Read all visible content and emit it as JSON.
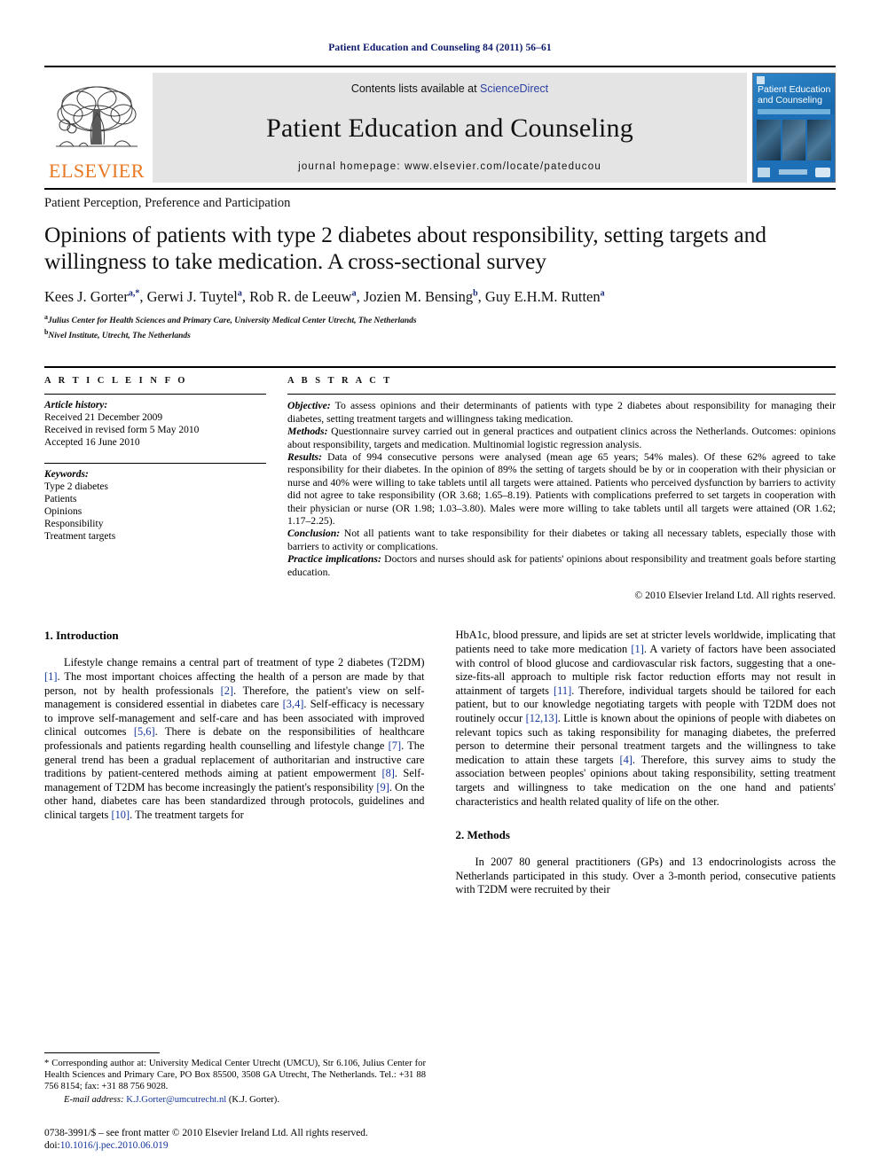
{
  "running_head": "Patient Education and Counseling 84 (2011) 56–61",
  "masthead": {
    "contents_prefix": "Contents lists available at",
    "sciencedirect": "ScienceDirect",
    "journal_title": "Patient Education and Counseling",
    "homepage": "journal homepage: www.elsevier.com/locate/pateducou",
    "publisher": "ELSEVIER",
    "cover_title": "Patient Education and Counseling",
    "link_color": "#2b3fa0",
    "brand_orange": "#e87722"
  },
  "section_heading": "Patient Perception, Preference and Participation",
  "article": {
    "title": "Opinions of patients with type 2 diabetes about responsibility, setting targets and willingness to take medication. A cross-sectional survey",
    "authors_html": "Kees J. Gorter<sup>a,*</sup>, Gerwi J. Tuytel<sup>a</sup>, Rob R. de Leeuw<sup>a</sup>, Jozien M. Bensing<sup>b</sup>, Guy E.H.M. Rutten<sup>a</sup>",
    "affiliation_a": "Julius Center for Health Sciences and Primary Care, University Medical Center Utrecht, The Netherlands",
    "affiliation_b": "Nivel Institute, Utrecht, The Netherlands"
  },
  "article_info": {
    "kicker": "A R T I C L E   I N F O",
    "history_label": "Article history:",
    "history": [
      "Received 21 December 2009",
      "Received in revised form 5 May 2010",
      "Accepted 16 June 2010"
    ],
    "keywords_label": "Keywords:",
    "keywords": [
      "Type 2 diabetes",
      "Patients",
      "Opinions",
      "Responsibility",
      "Treatment targets"
    ]
  },
  "abstract": {
    "kicker": "A B S T R A C T",
    "objective_label": "Objective:",
    "objective": "To assess opinions and their determinants of patients with type 2 diabetes about responsibility for managing their diabetes, setting treatment targets and willingness taking medication.",
    "methods_label": "Methods:",
    "methods": "Questionnaire survey carried out in general practices and outpatient clinics across the Netherlands. Outcomes: opinions about responsibility, targets and medication. Multinomial logistic regression analysis.",
    "results_label": "Results:",
    "results": "Data of 994 consecutive persons were analysed (mean age 65 years; 54% males). Of these 62% agreed to take responsibility for their diabetes. In the opinion of 89% the setting of targets should be by or in cooperation with their physician or nurse and 40% were willing to take tablets until all targets were attained. Patients who perceived dysfunction by barriers to activity did not agree to take responsibility (OR 3.68; 1.65–8.19). Patients with complications preferred to set targets in cooperation with their physician or nurse (OR 1.98; 1.03–3.80). Males were more willing to take tablets until all targets were attained (OR 1.62; 1.17–2.25).",
    "conclusion_label": "Conclusion:",
    "conclusion": "Not all patients want to take responsibility for their diabetes or taking all necessary tablets, especially those with barriers to activity or complications.",
    "implications_label": "Practice implications:",
    "implications": "Doctors and nurses should ask for patients' opinions about responsibility and treatment goals before starting education.",
    "copyright": "© 2010 Elsevier Ireland Ltd. All rights reserved."
  },
  "body": {
    "intro_heading": "1. Introduction",
    "intro_left_1": "Lifestyle change remains a central part of treatment of type 2 diabetes (T2DM) ",
    "intro_left_r1": "[1]",
    "intro_left_2": ". The most important choices affecting the health of a person are made by that person, not by health professionals ",
    "intro_left_r2": "[2]",
    "intro_left_3": ". Therefore, the patient's view on self-management is considered essential in diabetes care ",
    "intro_left_r3": "[3,4]",
    "intro_left_4": ". Self-efficacy is necessary to improve self-management and self-care and has been associated with improved clinical outcomes ",
    "intro_left_r4": "[5,6]",
    "intro_left_5": ". There is debate on the responsibilities of healthcare professionals and patients regarding health counselling and lifestyle change ",
    "intro_left_r5": "[7]",
    "intro_left_6": ". The general trend has been a gradual replacement of authoritarian and instructive care traditions by patient-centered methods aiming at patient empowerment ",
    "intro_left_r6": "[8]",
    "intro_left_7": ". Self-management of T2DM has become increasingly the patient's responsibility ",
    "intro_left_r7": "[9]",
    "intro_left_8": ". On the other hand, diabetes care has been standardized through protocols, guidelines and clinical targets ",
    "intro_left_r8": "[10]",
    "intro_left_9": ". The treatment targets for",
    "intro_right_1": "HbA1c, blood pressure, and lipids are set at stricter levels worldwide, implicating that patients need to take more medication ",
    "intro_right_r1": "[1]",
    "intro_right_2": ". A variety of factors have been associated with control of blood glucose and cardiovascular risk factors, suggesting that a one-size-fits-all approach to multiple risk factor reduction efforts may not result in attainment of targets ",
    "intro_right_r2": "[11]",
    "intro_right_3": ". Therefore, individual targets should be tailored for each patient, but to our knowledge negotiating targets with people with T2DM does not routinely occur ",
    "intro_right_r3": "[12,13]",
    "intro_right_4": ". Little is known about the opinions of people with diabetes on relevant topics such as taking responsibility for managing diabetes, the preferred person to determine their personal treatment targets and the willingness to take medication to attain these targets ",
    "intro_right_r4": "[4]",
    "intro_right_5": ". Therefore, this survey aims to study the association between peoples' opinions about taking responsibility, setting treatment targets and willingness to take medication on the one hand and patients' characteristics and health related quality of life on the other.",
    "methods_heading": "2. Methods",
    "methods_para": "In 2007 80 general practitioners (GPs) and 13 endocrinologists across the Netherlands participated in this study. Over a 3-month period, consecutive patients with T2DM were recruited by their"
  },
  "footnotes": {
    "corresponding": "* Corresponding author at: University Medical Center Utrecht (UMCU), Str 6.106, Julius Center for Health Sciences and Primary Care, PO Box 85500, 3508 GA Utrecht, The Netherlands. Tel.: +31 88 756 8154; fax: +31 88 756 9028.",
    "email_label": "E-mail address:",
    "email": "K.J.Gorter@umcutrecht.nl",
    "email_suffix": "(K.J. Gorter).",
    "imprint": "0738-3991/$ – see front matter © 2010 Elsevier Ireland Ltd. All rights reserved.",
    "doi_label": "doi:",
    "doi": "10.1016/j.pec.2010.06.019"
  }
}
